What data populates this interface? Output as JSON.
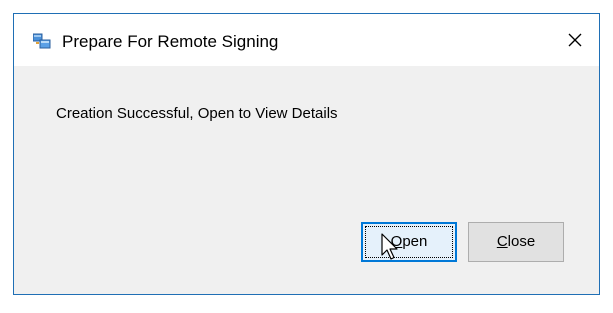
{
  "window": {
    "title": "Prepare For Remote Signing",
    "close_glyph": "×"
  },
  "dialog": {
    "message": "Creation Successful, Open to View Details"
  },
  "buttons": {
    "open": {
      "mnemonic": "O",
      "rest": "pen"
    },
    "close": {
      "mnemonic": "C",
      "rest": "lose"
    }
  },
  "icons": {
    "app": "app-window-icon",
    "close": "close-icon",
    "cursor": "mouse-pointer-icon"
  },
  "colors": {
    "window_border": "#1f6fb5",
    "titlebar_bg": "#ffffff",
    "client_bg": "#f0f0f0",
    "default_button_border": "#0078d7",
    "default_button_bg": "#e5f1fb"
  }
}
